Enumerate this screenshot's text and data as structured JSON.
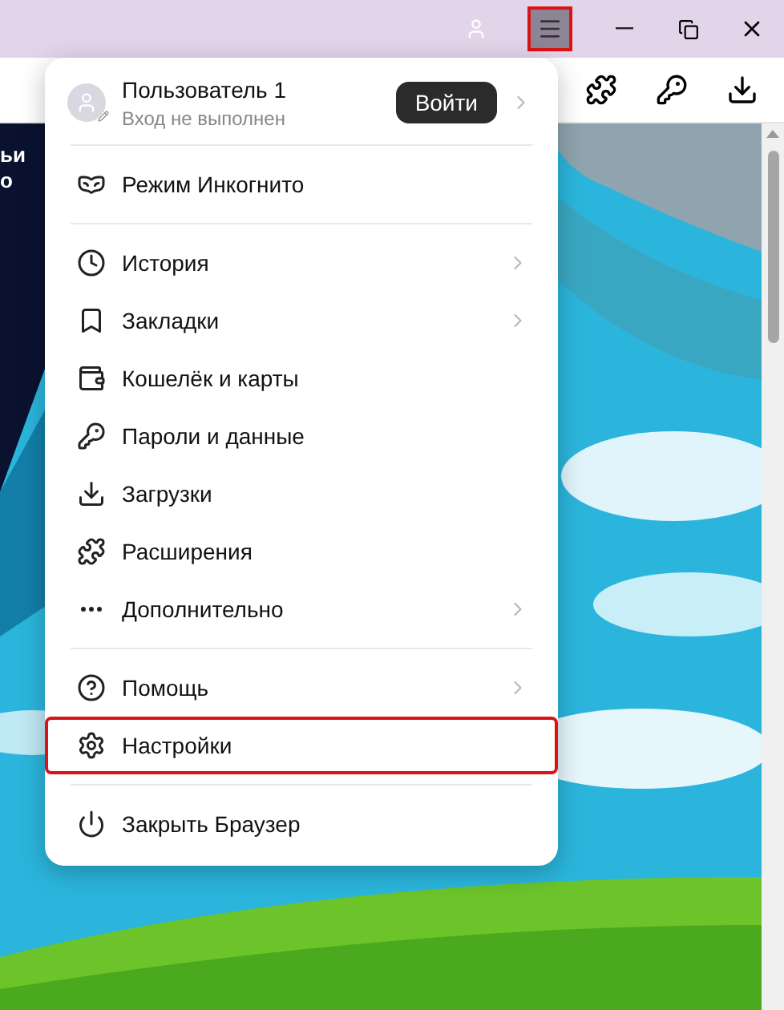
{
  "titlebar": {
    "menu_button": {
      "highlighted": true
    }
  },
  "page_text": [
    "ьи",
    "о"
  ],
  "menu": {
    "profile": {
      "name": "Пользователь 1",
      "status": "Вход не выполнен",
      "login_button": "Войти"
    },
    "sections": [
      {
        "items": [
          {
            "label": "Режим Инкогнито",
            "submenu": false,
            "highlighted": false
          }
        ]
      },
      {
        "items": [
          {
            "label": "История",
            "submenu": true,
            "highlighted": false
          },
          {
            "label": "Закладки",
            "submenu": true,
            "highlighted": false
          },
          {
            "label": "Кошелёк и карты",
            "submenu": false,
            "highlighted": false
          },
          {
            "label": "Пароли и данные",
            "submenu": false,
            "highlighted": false
          },
          {
            "label": "Загрузки",
            "submenu": false,
            "highlighted": false
          },
          {
            "label": "Расширения",
            "submenu": false,
            "highlighted": false
          },
          {
            "label": "Дополнительно",
            "submenu": true,
            "highlighted": false
          }
        ]
      },
      {
        "items": [
          {
            "label": "Помощь",
            "submenu": true,
            "highlighted": false
          },
          {
            "label": "Настройки",
            "submenu": false,
            "highlighted": true
          }
        ]
      },
      {
        "items": [
          {
            "label": "Закрыть Браузер",
            "submenu": false,
            "highlighted": false
          }
        ]
      }
    ]
  }
}
